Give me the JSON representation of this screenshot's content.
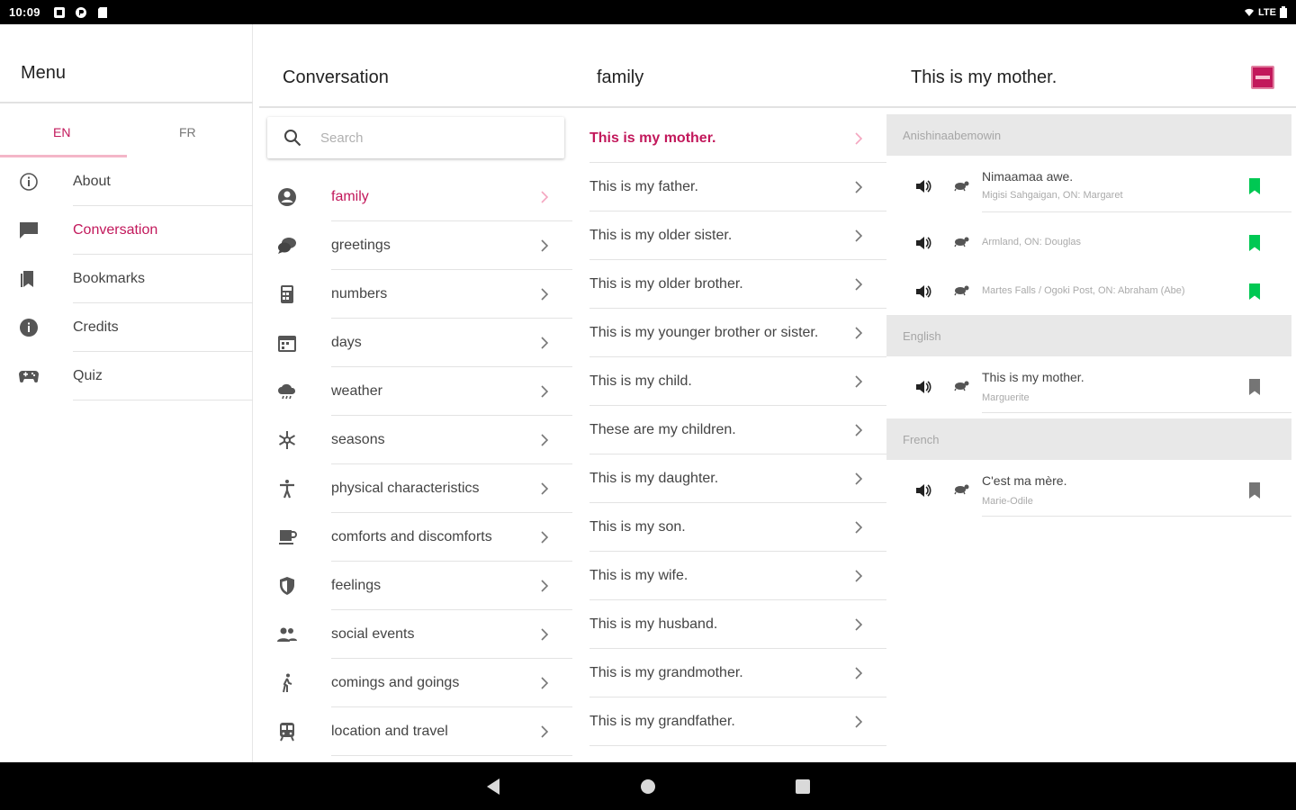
{
  "status_bar": {
    "time": "10:09",
    "network": "LTE"
  },
  "menu": {
    "title": "Menu",
    "lang_tabs": [
      "EN",
      "FR"
    ],
    "items": [
      {
        "label": "About",
        "icon": "info-outline-icon"
      },
      {
        "label": "Conversation",
        "icon": "chat-bubble-icon"
      },
      {
        "label": "Bookmarks",
        "icon": "bookmarks-icon"
      },
      {
        "label": "Credits",
        "icon": "info-filled-icon"
      },
      {
        "label": "Quiz",
        "icon": "gamepad-icon"
      }
    ],
    "active_item": "Conversation"
  },
  "topics": {
    "title": "Conversation",
    "search_placeholder": "Search",
    "items": [
      {
        "label": "family",
        "icon": "person-circle-icon"
      },
      {
        "label": "greetings",
        "icon": "chat-bubbles-icon"
      },
      {
        "label": "numbers",
        "icon": "calculator-icon"
      },
      {
        "label": "days",
        "icon": "calendar-icon"
      },
      {
        "label": "weather",
        "icon": "cloud-rain-icon"
      },
      {
        "label": "seasons",
        "icon": "snowflake-icon"
      },
      {
        "label": "physical characteristics",
        "icon": "accessibility-icon"
      },
      {
        "label": "comforts and discomforts",
        "icon": "coffee-icon"
      },
      {
        "label": "feelings",
        "icon": "heart-shield-icon"
      },
      {
        "label": "social events",
        "icon": "people-icon"
      },
      {
        "label": "comings and goings",
        "icon": "walking-icon"
      },
      {
        "label": "location and travel",
        "icon": "train-icon"
      }
    ],
    "active_item": "family"
  },
  "phrases": {
    "title": "family",
    "items": [
      "This is my mother.",
      "This is my father.",
      "This is my older sister.",
      "This is my older brother.",
      "This is my younger brother or sister.",
      "This is my child.",
      "These are my children.",
      "This is my daughter.",
      "This is my son.",
      "This is my wife.",
      "This is my husband.",
      "This is my grandmother.",
      "This is my grandfather."
    ],
    "active_item": "This is my mother."
  },
  "detail": {
    "title": "This is my mother.",
    "sections": [
      {
        "header": "Anishinaabemowin",
        "recordings": [
          {
            "text": "Nimaamaa awe.",
            "speaker": "Migisi Sahgaigan, ON: Margaret",
            "bookmarked": true
          },
          {
            "text": "",
            "speaker": "Armland, ON: Douglas",
            "bookmarked": true
          },
          {
            "text": "",
            "speaker": "Martes Falls / Ogoki Post, ON: Abraham (Abe)",
            "bookmarked": true
          }
        ]
      },
      {
        "header": "English",
        "recordings": [
          {
            "text": "This is my mother.",
            "speaker": "Marguerite",
            "bookmarked": false
          }
        ]
      },
      {
        "header": "French",
        "recordings": [
          {
            "text": "C'est ma mère.",
            "speaker": "Marie-Odile",
            "bookmarked": false
          }
        ]
      }
    ]
  },
  "colors": {
    "accent": "#c2185b",
    "bookmark_active": "#00c853",
    "bookmark_inactive": "#757575",
    "section_bg": "#e8e8e8"
  }
}
